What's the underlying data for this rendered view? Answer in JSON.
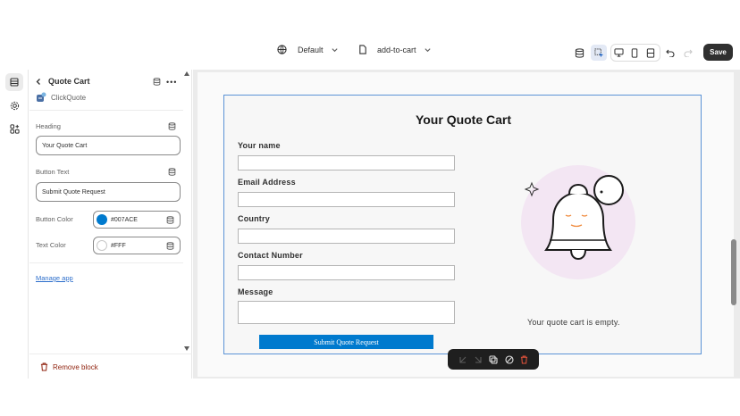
{
  "topbar": {
    "theme_label": "Default",
    "template_label": "add-to-cart",
    "save_label": "Save"
  },
  "sidebar": {
    "title": "Quote Cart",
    "app_name": "ClickQuote",
    "fields": {
      "heading_label": "Heading",
      "heading_value": "Your Quote Cart",
      "button_text_label": "Button Text",
      "button_text_value": "Submit Quote Request",
      "button_color_label": "Button Color",
      "button_color_value": "#007ACE",
      "text_color_label": "Text Color",
      "text_color_value": "#FFF"
    },
    "manage_app_label": "Manage app",
    "remove_block_label": "Remove block"
  },
  "preview": {
    "title": "Your Quote Cart",
    "fields": [
      {
        "label": "Your name"
      },
      {
        "label": "Email Address"
      },
      {
        "label": "Country"
      },
      {
        "label": "Contact Number"
      },
      {
        "label": "Message"
      }
    ],
    "submit_label": "Submit Quote Request",
    "empty_message": "Your quote cart is empty."
  },
  "colors": {
    "accent": "#007ACE",
    "save_bg": "#303030",
    "remove": "#8E1F0B",
    "selection": "#5B93D6"
  },
  "icons": [
    "globe-icon",
    "page-icon",
    "chevron-down-icon",
    "database-icon",
    "inspector-icon",
    "desktop-icon",
    "mobile-icon",
    "fullwidth-icon",
    "undo-icon",
    "redo-icon",
    "sections-icon",
    "settings-icon",
    "apps-icon",
    "back-arrow-icon",
    "more-icon",
    "trash-icon",
    "bell-illustration"
  ]
}
